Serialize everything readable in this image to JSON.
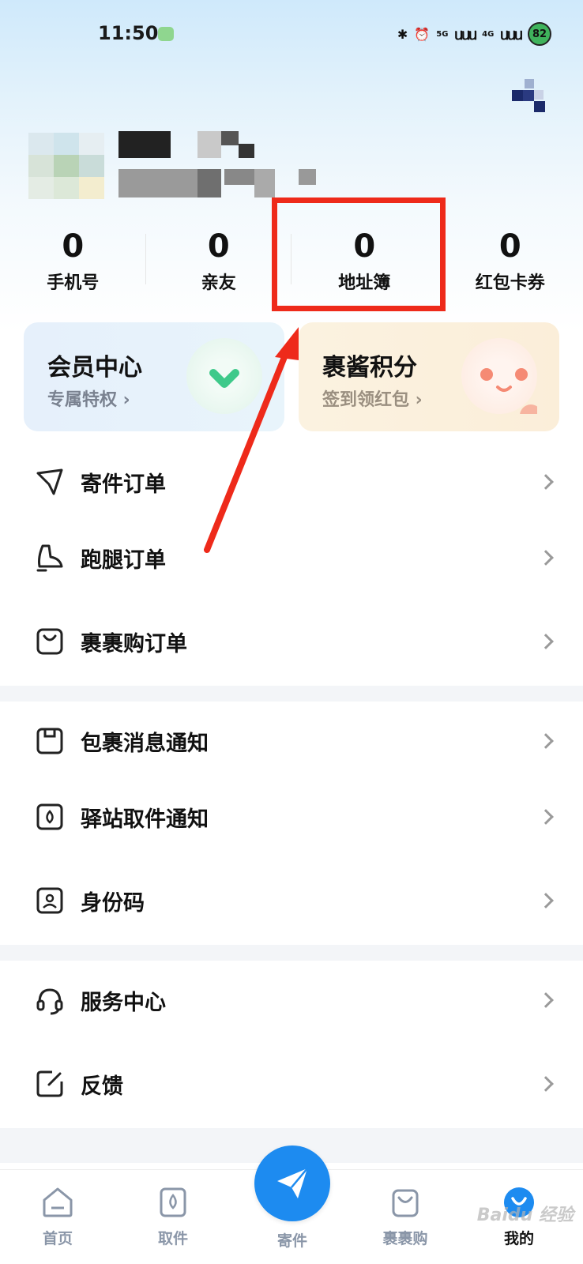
{
  "status_bar": {
    "time": "11:50",
    "network_5g": "5G",
    "network_4g": "4G",
    "battery": "82"
  },
  "stats": [
    {
      "value": "0",
      "label": "手机号"
    },
    {
      "value": "0",
      "label": "亲友"
    },
    {
      "value": "0",
      "label": "地址簿"
    },
    {
      "value": "0",
      "label": "红包卡券"
    }
  ],
  "cards": {
    "member": {
      "title": "会员中心",
      "subtitle": "专属特权 ›"
    },
    "points": {
      "title": "裹酱积分",
      "subtitle": "签到领红包 ›"
    }
  },
  "menu": {
    "orders": [
      {
        "label": "寄件订单",
        "icon": "send-icon"
      },
      {
        "label": "跑腿订单",
        "icon": "shoe-icon"
      },
      {
        "label": "裹裹购订单",
        "icon": "shopping-bag-icon"
      }
    ],
    "notifications": [
      {
        "label": "包裹消息通知",
        "icon": "package-icon"
      },
      {
        "label": "驿站取件通知",
        "icon": "station-icon"
      },
      {
        "label": "身份码",
        "icon": "id-code-icon"
      }
    ],
    "support": [
      {
        "label": "服务中心",
        "icon": "headset-icon"
      },
      {
        "label": "反馈",
        "icon": "edit-icon"
      }
    ]
  },
  "tabbar": {
    "home": "首页",
    "pickup": "取件",
    "send": "寄件",
    "shop": "裹裹购",
    "mine": "我的"
  },
  "colors": {
    "accent": "#1d8bf0",
    "highlight": "#ee2a1a"
  },
  "watermark": "Baidu 经验"
}
